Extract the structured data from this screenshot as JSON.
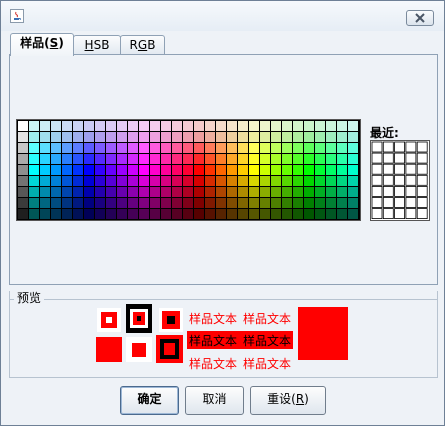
{
  "window": {
    "title": ""
  },
  "tabs": [
    {
      "label": "样品(",
      "mnemonic": "S",
      "suffix": ")",
      "active": true
    },
    {
      "label": "",
      "mnemonic": "H",
      "suffix": "SB",
      "active": false
    },
    {
      "label": "R",
      "mnemonic": "G",
      "suffix": "B",
      "active": false
    }
  ],
  "swatches": {
    "label": "最近:"
  },
  "preview": {
    "label": "预览",
    "sample_text": "样品文本",
    "color": "#ff0000"
  },
  "buttons": {
    "ok": {
      "label": "确定"
    },
    "cancel": {
      "label": "取消"
    },
    "reset": {
      "label": "重设(",
      "mnemonic": "R",
      "suffix": ")"
    }
  }
}
